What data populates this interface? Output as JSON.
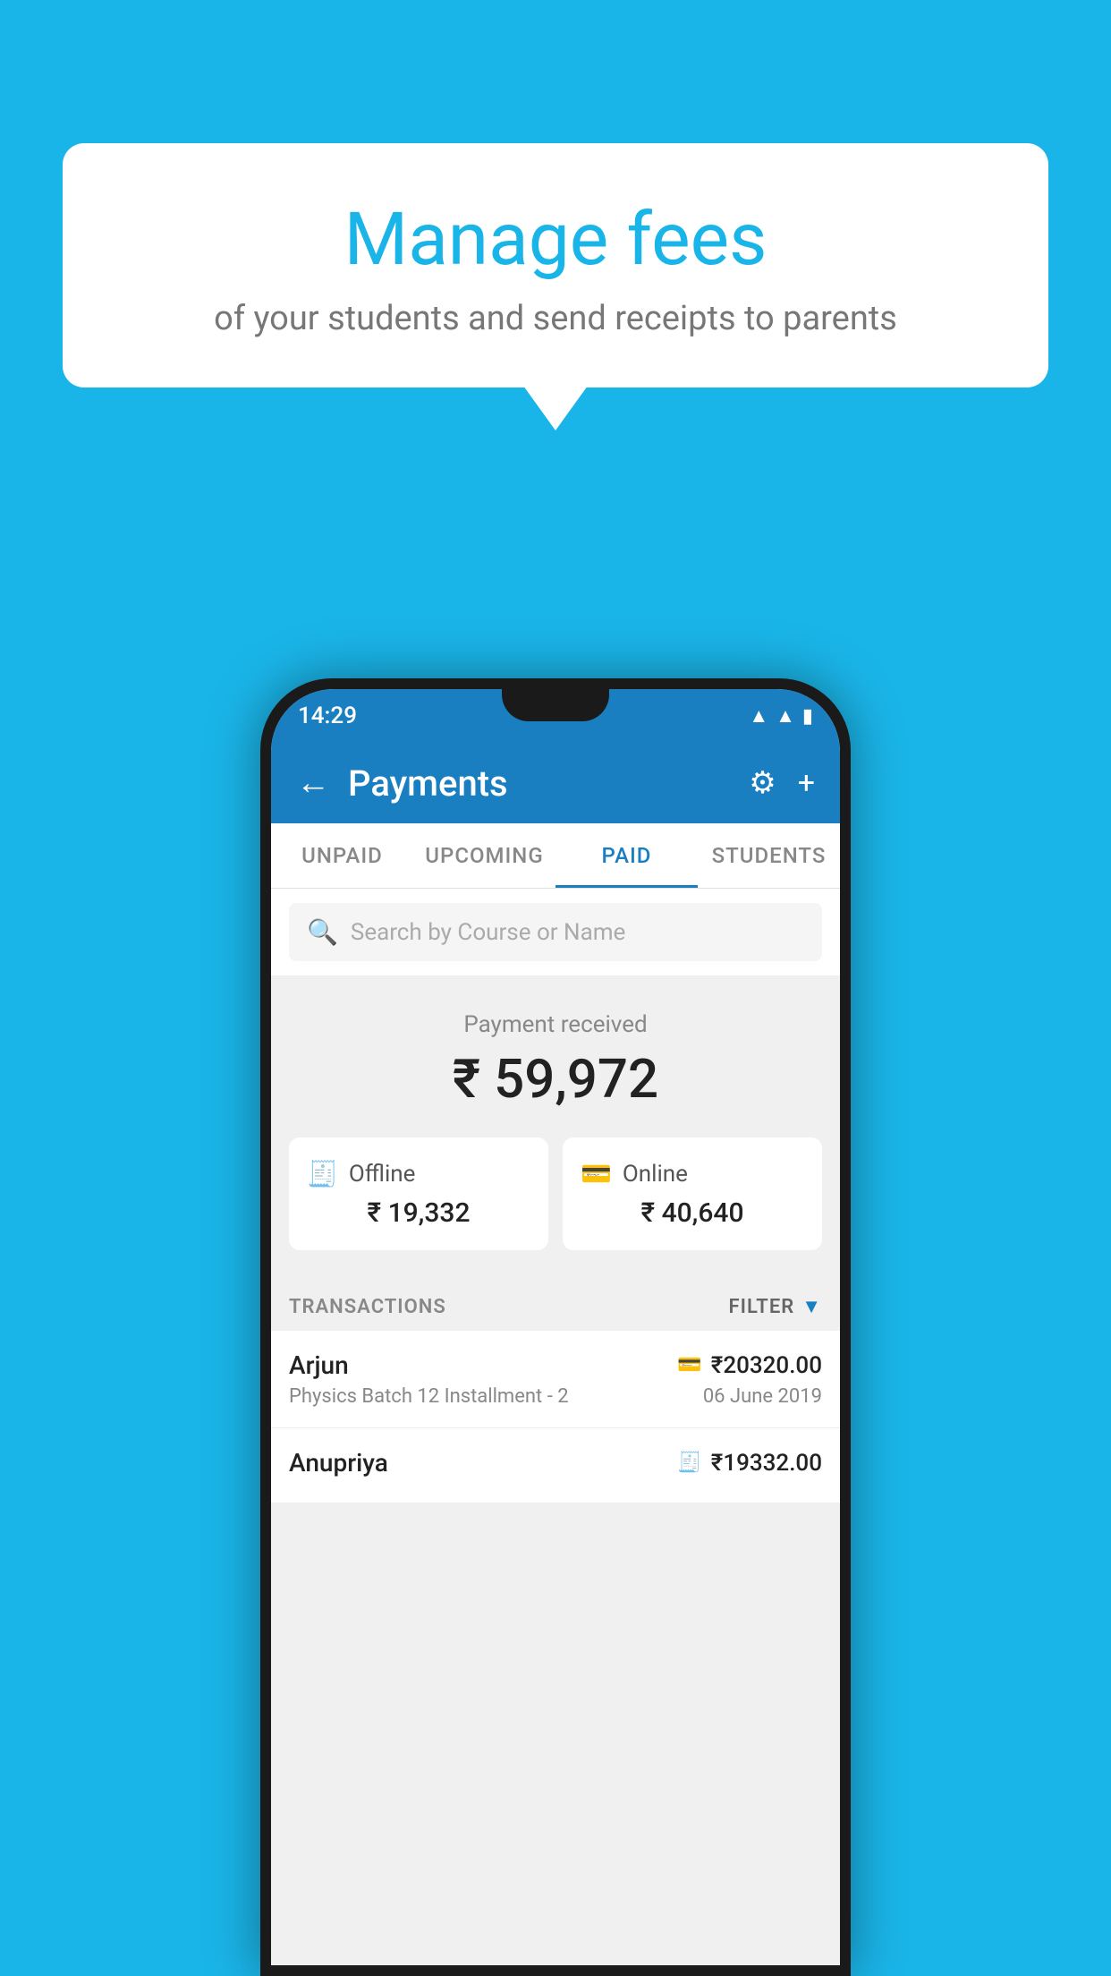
{
  "background_color": "#1ab5e8",
  "bubble": {
    "title": "Manage fees",
    "subtitle": "of your students and send receipts to parents"
  },
  "status_bar": {
    "time": "14:29",
    "icons": [
      "wifi",
      "signal",
      "battery"
    ]
  },
  "header": {
    "title": "Payments",
    "back_label": "←",
    "settings_label": "⚙",
    "add_label": "+"
  },
  "tabs": [
    {
      "label": "UNPAID",
      "active": false
    },
    {
      "label": "UPCOMING",
      "active": false
    },
    {
      "label": "PAID",
      "active": true
    },
    {
      "label": "STUDENTS",
      "active": false
    }
  ],
  "search": {
    "placeholder": "Search by Course or Name"
  },
  "payment_summary": {
    "label": "Payment received",
    "total": "₹ 59,972",
    "offline_label": "Offline",
    "offline_amount": "₹ 19,332",
    "online_label": "Online",
    "online_amount": "₹ 40,640"
  },
  "transactions_section": {
    "label": "TRANSACTIONS",
    "filter_label": "FILTER"
  },
  "transactions": [
    {
      "name": "Arjun",
      "course": "Physics Batch 12 Installment - 2",
      "amount": "₹20320.00",
      "date": "06 June 2019",
      "type": "online"
    },
    {
      "name": "Anupriya",
      "course": "",
      "amount": "₹19332.00",
      "date": "",
      "type": "offline"
    }
  ]
}
